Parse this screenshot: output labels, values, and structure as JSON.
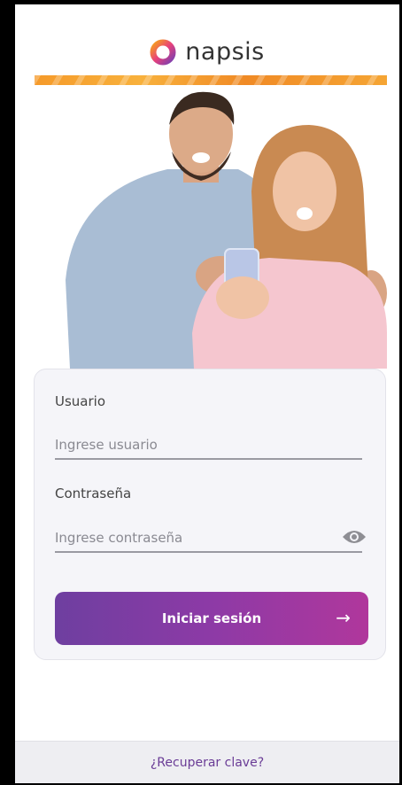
{
  "brand": {
    "name": "napsis"
  },
  "login": {
    "user_label": "Usuario",
    "user_placeholder": "Ingrese usuario",
    "password_label": "Contraseña",
    "password_placeholder": "Ingrese contraseña",
    "submit_label": "Iniciar sesión",
    "submit_arrow": "→"
  },
  "footer": {
    "recover_label": "¿Recuperar clave?"
  },
  "colors": {
    "primary_start": "#6e3fa0",
    "primary_end": "#b0379c",
    "link": "#6a3c96",
    "accent_orange": "#f59a2a"
  }
}
